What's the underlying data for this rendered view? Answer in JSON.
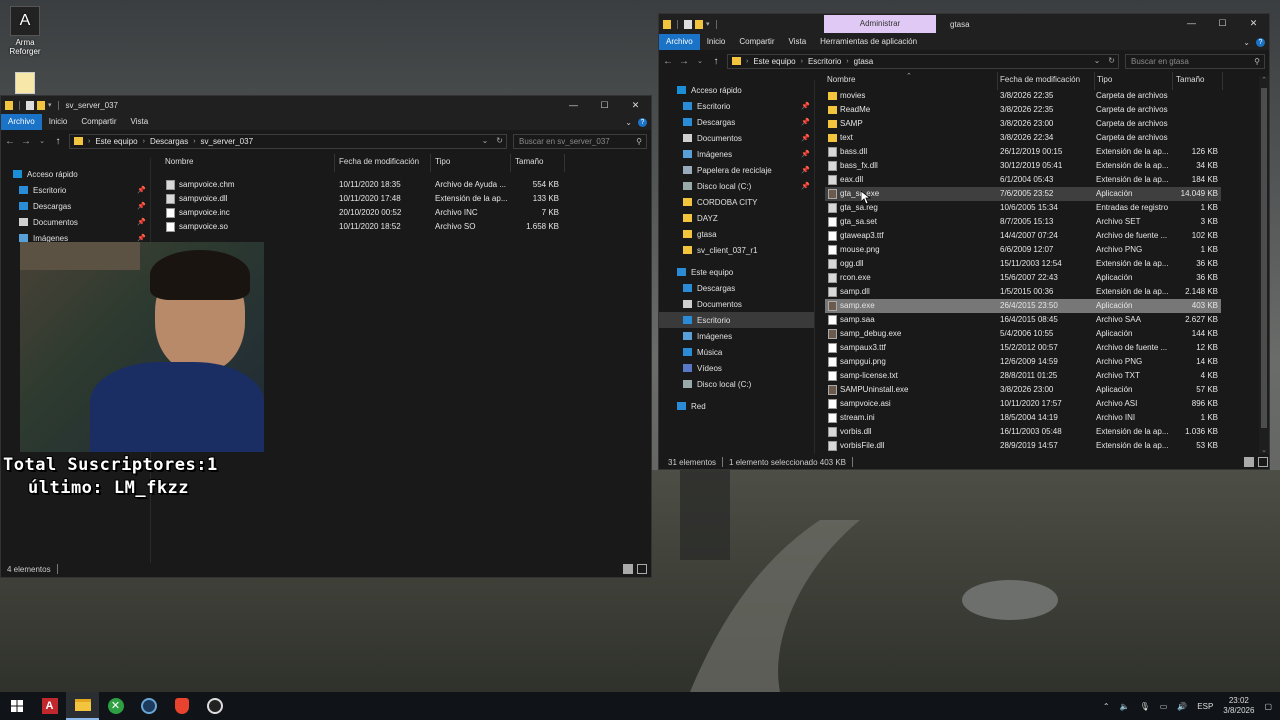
{
  "desktop": {
    "icons": [
      {
        "label": "Arma Reforger"
      }
    ]
  },
  "overlay": {
    "subscribers_line": "Total Suscriptores:1",
    "last_line": "último: LM_fkzz"
  },
  "left_window": {
    "title": "sv_server_037",
    "ribbon": [
      "Archivo",
      "Inicio",
      "Compartir",
      "Vista"
    ],
    "path": [
      "Este equipo",
      "Descargas",
      "sv_server_037"
    ],
    "search_placeholder": "Buscar en sv_server_037",
    "nav": [
      "Acceso rápido",
      "Escritorio",
      "Descargas",
      "Documentos",
      "Imágenes"
    ],
    "columns": [
      "Nombre",
      "Fecha de modificación",
      "Tipo",
      "Tamaño"
    ],
    "files": [
      {
        "name": "sampvoice.chm",
        "date": "10/11/2020 18:35",
        "type": "Archivo de Ayuda ...",
        "size": "554 KB"
      },
      {
        "name": "sampvoice.dll",
        "date": "10/11/2020 17:48",
        "type": "Extensión de la ap...",
        "size": "133 KB"
      },
      {
        "name": "sampvoice.inc",
        "date": "20/10/2020 00:52",
        "type": "Archivo INC",
        "size": "7 KB"
      },
      {
        "name": "sampvoice.so",
        "date": "10/11/2020 18:52",
        "type": "Archivo SO",
        "size": "1.658 KB"
      }
    ],
    "status": "4 elementos"
  },
  "right_window": {
    "title": "gtasa",
    "context_tab": "Administrar",
    "ribbon": [
      "Archivo",
      "Inicio",
      "Compartir",
      "Vista",
      "Herramientas de aplicación"
    ],
    "path": [
      "Este equipo",
      "Escritorio",
      "gtasa"
    ],
    "search_placeholder": "Buscar en gtasa",
    "nav": [
      {
        "label": "Acceso rápido",
        "color": "#1a8fd8",
        "pin": false
      },
      {
        "label": "Escritorio",
        "color": "#2a8bd6",
        "pin": true
      },
      {
        "label": "Descargas",
        "color": "#2a8bd6",
        "pin": true
      },
      {
        "label": "Documentos",
        "color": "#cfcfcf",
        "pin": true
      },
      {
        "label": "Imágenes",
        "color": "#5aa0d8",
        "pin": true
      },
      {
        "label": "Papelera de reciclaje",
        "color": "#9ab",
        "pin": true
      },
      {
        "label": "Disco local (C:)",
        "color": "#9aa",
        "pin": true
      },
      {
        "label": "CORDOBA CITY",
        "color": "#f3c53f",
        "pin": false
      },
      {
        "label": "DAYZ",
        "color": "#f3c53f",
        "pin": false
      },
      {
        "label": "gtasa",
        "color": "#f3c53f",
        "pin": false
      },
      {
        "label": "sv_client_037_r1",
        "color": "#f3c53f",
        "pin": false
      },
      {
        "label": "Este equipo",
        "color": "#2a8bd6",
        "pin": false
      },
      {
        "label": "Descargas",
        "color": "#2a8bd6",
        "pin": false
      },
      {
        "label": "Documentos",
        "color": "#cfcfcf",
        "pin": false
      },
      {
        "label": "Escritorio",
        "color": "#2a8bd6",
        "pin": false
      },
      {
        "label": "Imágenes",
        "color": "#5aa0d8",
        "pin": false
      },
      {
        "label": "Música",
        "color": "#2a8bd6",
        "pin": false
      },
      {
        "label": "Vídeos",
        "color": "#5a78c8",
        "pin": false
      },
      {
        "label": "Disco local (C:)",
        "color": "#9aa",
        "pin": false
      },
      {
        "label": "Red",
        "color": "#2a8bd6",
        "pin": false
      }
    ],
    "columns": [
      "Nombre",
      "Fecha de modificación",
      "Tipo",
      "Tamaño"
    ],
    "files": [
      {
        "name": "movies",
        "date": "3/8/2026 22:35",
        "type": "Carpeta de archivos",
        "size": "",
        "icon": "folder"
      },
      {
        "name": "ReadMe",
        "date": "3/8/2026 22:35",
        "type": "Carpeta de archivos",
        "size": "",
        "icon": "folder"
      },
      {
        "name": "SAMP",
        "date": "3/8/2026 23:00",
        "type": "Carpeta de archivos",
        "size": "",
        "icon": "folder"
      },
      {
        "name": "text",
        "date": "3/8/2026 22:34",
        "type": "Carpeta de archivos",
        "size": "",
        "icon": "folder"
      },
      {
        "name": "bass.dll",
        "date": "26/12/2019 00:15",
        "type": "Extensión de la ap...",
        "size": "126 KB",
        "icon": "dll"
      },
      {
        "name": "bass_fx.dll",
        "date": "30/12/2019 05:41",
        "type": "Extensión de la ap...",
        "size": "34 KB",
        "icon": "dll"
      },
      {
        "name": "eax.dll",
        "date": "6/1/2004 05:43",
        "type": "Extensión de la ap...",
        "size": "184 KB",
        "icon": "dll"
      },
      {
        "name": "gta_sa.exe",
        "date": "7/6/2005 23:52",
        "type": "Aplicación",
        "size": "14.049 KB",
        "icon": "exe"
      },
      {
        "name": "gta_sa.reg",
        "date": "10/6/2005 15:34",
        "type": "Entradas de registro",
        "size": "1 KB",
        "icon": "dll"
      },
      {
        "name": "gta_sa.set",
        "date": "8/7/2005 15:13",
        "type": "Archivo SET",
        "size": "3 KB",
        "icon": "txt"
      },
      {
        "name": "gtaweap3.ttf",
        "date": "14/4/2007 07:24",
        "type": "Archivo de fuente ...",
        "size": "102 KB",
        "icon": "txt"
      },
      {
        "name": "mouse.png",
        "date": "6/6/2009 12:07",
        "type": "Archivo PNG",
        "size": "1 KB",
        "icon": "txt"
      },
      {
        "name": "ogg.dll",
        "date": "15/11/2003 12:54",
        "type": "Extensión de la ap...",
        "size": "36 KB",
        "icon": "dll"
      },
      {
        "name": "rcon.exe",
        "date": "15/6/2007 22:43",
        "type": "Aplicación",
        "size": "36 KB",
        "icon": "dll"
      },
      {
        "name": "samp.dll",
        "date": "1/5/2015 00:36",
        "type": "Extensión de la ap...",
        "size": "2.148 KB",
        "icon": "dll"
      },
      {
        "name": "samp.exe",
        "date": "26/4/2015 23:50",
        "type": "Aplicación",
        "size": "403 KB",
        "icon": "exe"
      },
      {
        "name": "samp.saa",
        "date": "16/4/2015 08:45",
        "type": "Archivo SAA",
        "size": "2.627 KB",
        "icon": "txt"
      },
      {
        "name": "samp_debug.exe",
        "date": "5/4/2006 10:55",
        "type": "Aplicación",
        "size": "144 KB",
        "icon": "exe"
      },
      {
        "name": "sampaux3.ttf",
        "date": "15/2/2012 00:57",
        "type": "Archivo de fuente ...",
        "size": "12 KB",
        "icon": "txt"
      },
      {
        "name": "sampgui.png",
        "date": "12/6/2009 14:59",
        "type": "Archivo PNG",
        "size": "14 KB",
        "icon": "txt"
      },
      {
        "name": "samp-license.txt",
        "date": "28/8/2011 01:25",
        "type": "Archivo TXT",
        "size": "4 KB",
        "icon": "txt"
      },
      {
        "name": "SAMPUninstall.exe",
        "date": "3/8/2026 23:00",
        "type": "Aplicación",
        "size": "57 KB",
        "icon": "exe"
      },
      {
        "name": "sampvoice.asi",
        "date": "10/11/2020 17:57",
        "type": "Archivo ASI",
        "size": "896 KB",
        "icon": "txt"
      },
      {
        "name": "stream.ini",
        "date": "18/5/2004 14:19",
        "type": "Archivo INI",
        "size": "1 KB",
        "icon": "txt"
      },
      {
        "name": "vorbis.dll",
        "date": "16/11/2003 05:48",
        "type": "Extensión de la ap...",
        "size": "1.036 KB",
        "icon": "dll"
      },
      {
        "name": "vorbisFile.dll",
        "date": "28/9/2019 14:57",
        "type": "Extensión de la ap...",
        "size": "53 KB",
        "icon": "dll"
      }
    ],
    "selected_row": "samp.exe",
    "hover_row": "gta_sa.exe",
    "status_count": "31 elementos",
    "status_selected": "1 elemento seleccionado  403 KB"
  },
  "taskbar": {
    "lang": "ESP",
    "time": "23:02",
    "date": "3/8/2026"
  }
}
